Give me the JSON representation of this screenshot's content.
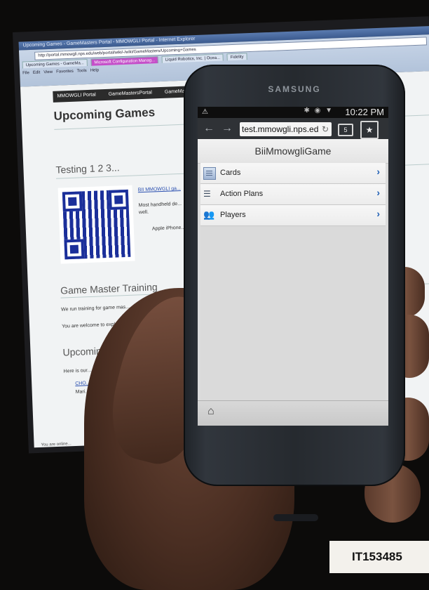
{
  "monitor": {
    "window_title": "Upcoming Games - GameMasters Portal - MMOWGLI Portal - Internet Explorer",
    "address": "http://portal.mmowgli.nps.edu/web/portal/wiki/-/wiki/GameMasters/Upcoming+Games",
    "tabs": [
      "Upcoming Games - GameMa...",
      "Microsoft Configuration Manag...",
      "Liquid Robotics, Inc. | Ocea...",
      "Fidelity"
    ],
    "menu": [
      "File",
      "Edit",
      "View",
      "Favorites",
      "Tools",
      "Help"
    ],
    "breadcrumb": [
      "MMOWGLI Portal",
      "GameMastersPortal",
      "GameMast..."
    ],
    "page_title": "Upcoming Games",
    "section_testing": "Testing 1 2 3...",
    "qr_link": "BII MMOWGLI ga...",
    "handheld_text_1": "Most handheld de...",
    "handheld_text_2": "well.",
    "bullet_apple": "Apple iPhone...",
    "section_training": "Game Master Training",
    "training_text_1": "We run training for game mas...",
    "training_text_2": "You are welcome to explo...",
    "section_upcoming": "Upcoming",
    "upcoming_text": "Here is our...",
    "upcoming_bullet_1": "CHO...",
    "upcoming_bullet_2": "Mari...",
    "status_text": "You are online..."
  },
  "phone": {
    "brand": "SAMSUNG",
    "status_time": "10:22 PM",
    "status_warning": "⚠",
    "status_icons": "✱ ◉ ▼",
    "url": "test.mmowgli.nps.ed",
    "tab_count": "5",
    "nav_back": "←",
    "nav_forward": "→",
    "reload_glyph": "↻",
    "bookmark_glyph": "★",
    "home_glyph": "⌂",
    "app_title": "BiiMmowgliGame",
    "list_items": [
      {
        "label": "Cards",
        "icon": "cards-icon"
      },
      {
        "label": "Action Plans",
        "icon": "action-plans-icon"
      },
      {
        "label": "Players",
        "icon": "players-icon"
      }
    ],
    "chevron": "›"
  },
  "asset_tag": "IT153485"
}
